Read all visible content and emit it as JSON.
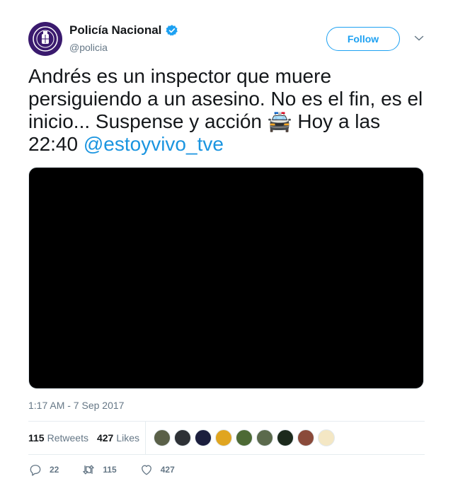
{
  "author": {
    "name": "Policía Nacional",
    "handle": "@policia",
    "avatar_icon": "police-crest-icon",
    "verified": true
  },
  "follow_label": "Follow",
  "tweet": {
    "text_main": "Andrés es un inspector que muere persiguiendo a un asesino. No es el fin, es el inicio... Suspense y acción 🚔 Hoy a las 22:40 ",
    "mention": "@estoyvivo_tve"
  },
  "timestamp": "1:17 AM - 7 Sep 2017",
  "stats": {
    "retweets_count": "115",
    "retweets_label": "Retweets",
    "likes_count": "427",
    "likes_label": "Likes"
  },
  "likers": [
    {
      "color": "#5a6048"
    },
    {
      "color": "#2e3136"
    },
    {
      "color": "#1b1e3d"
    },
    {
      "color": "#e0a520"
    },
    {
      "color": "#4d6a35"
    },
    {
      "color": "#5b6a4c"
    },
    {
      "color": "#1c2a1c"
    },
    {
      "color": "#8a4a3a"
    },
    {
      "color": "#f4e7c4"
    }
  ],
  "actions": {
    "replies": "22",
    "retweets": "115",
    "likes": "427"
  },
  "colors": {
    "accent": "#1da1f2",
    "link": "#1b95e0",
    "secondary_text": "#657786"
  }
}
